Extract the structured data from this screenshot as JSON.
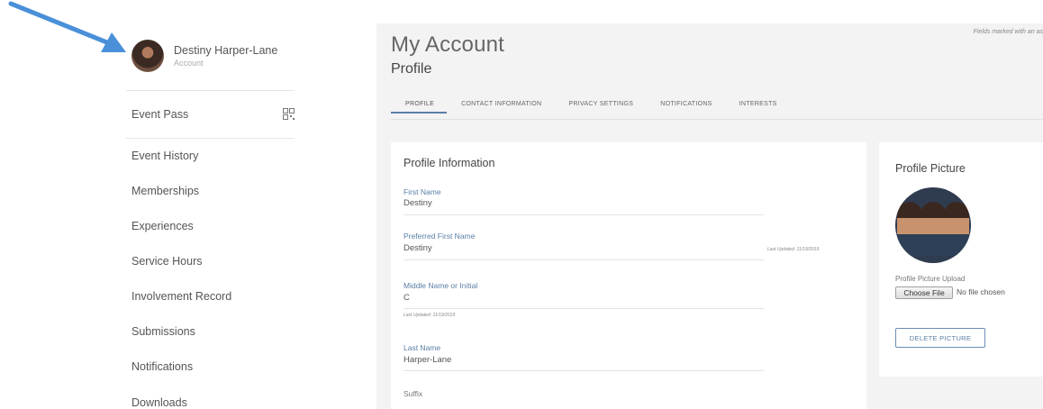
{
  "user": {
    "name": "Destiny Harper-Lane",
    "subtitle": "Account"
  },
  "sidebar": {
    "items": [
      {
        "label": "Event Pass",
        "icon": "qr-code-icon"
      },
      {
        "label": "Event History"
      },
      {
        "label": "Memberships"
      },
      {
        "label": "Experiences"
      },
      {
        "label": "Service Hours"
      },
      {
        "label": "Involvement Record"
      },
      {
        "label": "Submissions"
      },
      {
        "label": "Notifications"
      },
      {
        "label": "Downloads"
      }
    ]
  },
  "page": {
    "title": "My Account",
    "subtitle": "Profile",
    "fields_note": "Fields marked with an as"
  },
  "tabs": [
    {
      "label": "PROFILE",
      "active": true
    },
    {
      "label": "CONTACT INFORMATION",
      "active": false
    },
    {
      "label": "PRIVACY SETTINGS",
      "active": false
    },
    {
      "label": "NOTIFICATIONS",
      "active": false
    },
    {
      "label": "INTERESTS",
      "active": false
    }
  ],
  "profile_info": {
    "title": "Profile Information",
    "fields": [
      {
        "label": "First Name",
        "value": "Destiny"
      },
      {
        "label": "Preferred First Name",
        "value": "Destiny",
        "note": "Last Updated: 11/19/2019"
      },
      {
        "label": "Middle Name or Initial",
        "value": "C",
        "note": "Last Updated: 11/19/2019"
      },
      {
        "label": "Last Name",
        "value": "Harper-Lane"
      },
      {
        "label": "Suffix",
        "value": ""
      }
    ]
  },
  "profile_picture": {
    "title": "Profile Picture",
    "upload_label": "Profile Picture Upload",
    "choose_file_label": "Choose File",
    "no_file_text": "No file chosen",
    "delete_label": "DELETE PICTURE"
  },
  "colors": {
    "accent": "#5b7fa6",
    "arrow": "#4a90d9",
    "panel_bg": "#f3f3f3"
  }
}
